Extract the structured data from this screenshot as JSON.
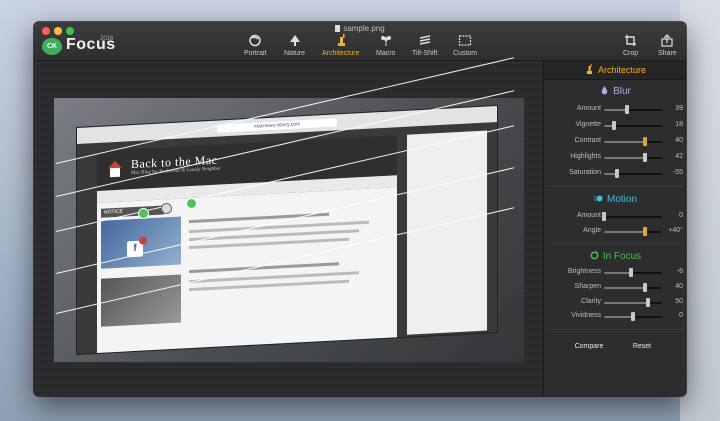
{
  "window": {
    "file_name": "sample.png"
  },
  "app": {
    "logo_text": "CK",
    "name": "Focus",
    "year": "2016"
  },
  "toolbar": {
    "modes": [
      {
        "label": "Portrait",
        "icon": "portrait-icon",
        "active": false
      },
      {
        "label": "Nature",
        "icon": "tree-icon",
        "active": false
      },
      {
        "label": "Architecture",
        "icon": "statue-of-liberty-icon",
        "active": true
      },
      {
        "label": "Macro",
        "icon": "flower-icon",
        "active": false
      },
      {
        "label": "Tilt-Shift",
        "icon": "tilt-shift-icon",
        "active": false
      },
      {
        "label": "Custom",
        "icon": "custom-icon",
        "active": false
      }
    ],
    "crop_label": "Crop",
    "share_label": "Share"
  },
  "photo": {
    "url_text": "macnews.tistory.com",
    "site_title": "Back to the Mac",
    "site_subtitle": "Mac Blog for Backsosor & Lonely Neighbor",
    "notice_label": "NOTICE"
  },
  "panel": {
    "header": "Architecture",
    "blur": {
      "title": "Blur",
      "rows": [
        {
          "label": "Amount",
          "value": "39",
          "level": 0.39,
          "mark": false
        },
        {
          "label": "Vignette",
          "value": "18",
          "level": 0.18,
          "mark": false
        },
        {
          "label": "Contrast",
          "value": "40",
          "level": 0.7,
          "mark": true
        },
        {
          "label": "Highlights",
          "value": "42",
          "level": 0.71,
          "mark": false
        },
        {
          "label": "Saturation",
          "value": "-55",
          "level": 0.22,
          "mark": false
        }
      ]
    },
    "motion": {
      "title": "Motion",
      "rows": [
        {
          "label": "Amount",
          "value": "0",
          "level": 0.0,
          "mark": false
        },
        {
          "label": "Angle",
          "value": "+40°",
          "level": 0.71,
          "mark": true
        }
      ]
    },
    "in_focus": {
      "title": "In Focus",
      "rows": [
        {
          "label": "Brightness",
          "value": "-6",
          "level": 0.47,
          "mark": false
        },
        {
          "label": "Sharpen",
          "value": "40",
          "level": 0.7,
          "mark": false
        },
        {
          "label": "Clarity",
          "value": "50",
          "level": 0.75,
          "mark": false
        },
        {
          "label": "Vividness",
          "value": "0",
          "level": 0.5,
          "mark": false
        }
      ]
    },
    "compare_label": "Compare",
    "reset_label": "Reset"
  },
  "colors": {
    "accent": "#f0b323",
    "blur_icon": "#b9a6e6",
    "motion_icon": "#39c0d8",
    "focus_icon": "#45c14e"
  }
}
